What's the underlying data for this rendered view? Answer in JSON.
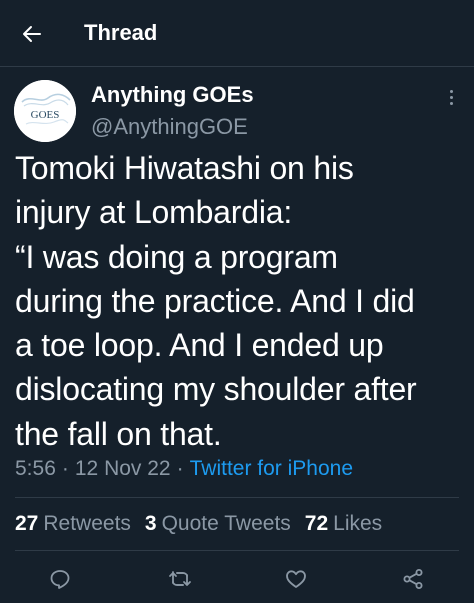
{
  "header": {
    "title": "Thread",
    "back_icon": "arrow-left-icon"
  },
  "tweet": {
    "author": {
      "display_name": "Anything GOEs",
      "handle": "@AnythingGOE",
      "avatar_text": "GOES"
    },
    "text": "Tomoki Hiwatashi on his\ninjury at Lombardia:\n“I was doing a program\nduring the practice. And I did\na toe loop. And I ended up\ndislocating my shoulder after\nthe fall on that.",
    "time": "5:56",
    "date": "12 Nov 22",
    "source": "Twitter for iPhone",
    "separator": "·"
  },
  "stats": {
    "retweets": {
      "count": "27",
      "label": "Retweets"
    },
    "quotes": {
      "count": "3",
      "label": "Quote Tweets"
    },
    "likes": {
      "count": "72",
      "label": "Likes"
    }
  },
  "actions": [
    "reply-icon",
    "retweet-icon",
    "like-icon",
    "share-icon"
  ],
  "colors": {
    "background": "#15202b",
    "text": "#ffffff",
    "secondary": "#8b98a5",
    "link": "#1d9bf0",
    "divider": "#2f3b47"
  }
}
